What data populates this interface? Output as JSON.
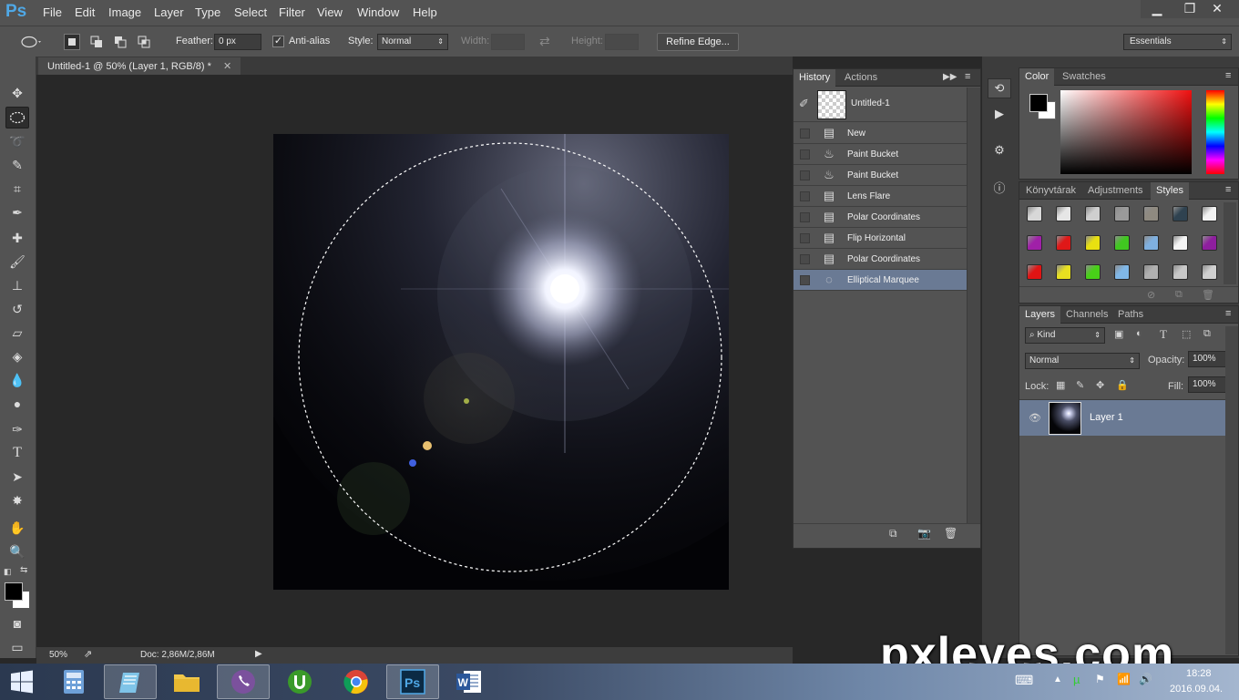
{
  "app": {
    "logo": "Ps"
  },
  "menu": [
    "File",
    "Edit",
    "Image",
    "Layer",
    "Type",
    "Select",
    "Filter",
    "View",
    "Window",
    "Help"
  ],
  "window_controls": {
    "minimize": "▁",
    "restore": "❐",
    "close": "✕"
  },
  "options": {
    "feather_label": "Feather:",
    "feather_value": "0 px",
    "antialias_label": "Anti-alias",
    "antialias_checked": true,
    "style_label": "Style:",
    "style_value": "Normal",
    "width_label": "Width:",
    "height_label": "Height:",
    "refine_edge": "Refine Edge...",
    "workspace": "Essentials"
  },
  "document": {
    "tab_title": "Untitled-1 @ 50% (Layer 1, RGB/8) *",
    "zoom": "50%",
    "doc_info": "Doc: 2,86M/2,86M"
  },
  "history": {
    "tabs": [
      "History",
      "Actions"
    ],
    "snapshot": "Untitled-1",
    "items": [
      {
        "label": "New",
        "icon": "doc-icon"
      },
      {
        "label": "Paint Bucket",
        "icon": "paint-bucket-icon"
      },
      {
        "label": "Paint Bucket",
        "icon": "paint-bucket-icon"
      },
      {
        "label": "Lens Flare",
        "icon": "doc-icon"
      },
      {
        "label": "Polar Coordinates",
        "icon": "doc-icon"
      },
      {
        "label": "Flip Horizontal",
        "icon": "doc-icon"
      },
      {
        "label": "Polar Coordinates",
        "icon": "doc-icon"
      },
      {
        "label": "Elliptical Marquee",
        "icon": "ellipse-marquee-icon"
      }
    ]
  },
  "color_panel": {
    "tabs": [
      "Color",
      "Swatches"
    ],
    "foreground": "#000000",
    "background": "#ffffff"
  },
  "styles_panel": {
    "tabs": [
      "Könyvtárak",
      "Adjustments",
      "Styles"
    ],
    "swatches": [
      "#d8d8d8",
      "#e6e6e6",
      "#cfcfcf",
      "#9a9a9a",
      "#8f8a80",
      "#2f4250",
      "#f2f2f2",
      "#a020a8",
      "#e01818",
      "#e8e010",
      "#40c820",
      "#7fb0e0",
      "#f4f4f4",
      "#8e1e9e",
      "#e01414",
      "#e8e020",
      "#48d018",
      "#80b8e8",
      "#b0b0b0",
      "#c8c8c8",
      "#d0d0d0"
    ]
  },
  "layers_panel": {
    "tabs": [
      "Layers",
      "Channels",
      "Paths"
    ],
    "filter_kind": "Kind",
    "blend_mode": "Normal",
    "opacity_label": "Opacity:",
    "opacity_value": "100%",
    "lock_label": "Lock:",
    "fill_label": "Fill:",
    "fill_value": "100%",
    "layers": [
      {
        "name": "Layer 1",
        "visible": true
      }
    ]
  },
  "taskbar": {
    "clock_time": "18:28",
    "clock_date": "2016.09.04."
  },
  "watermark": "pxleyes.com"
}
